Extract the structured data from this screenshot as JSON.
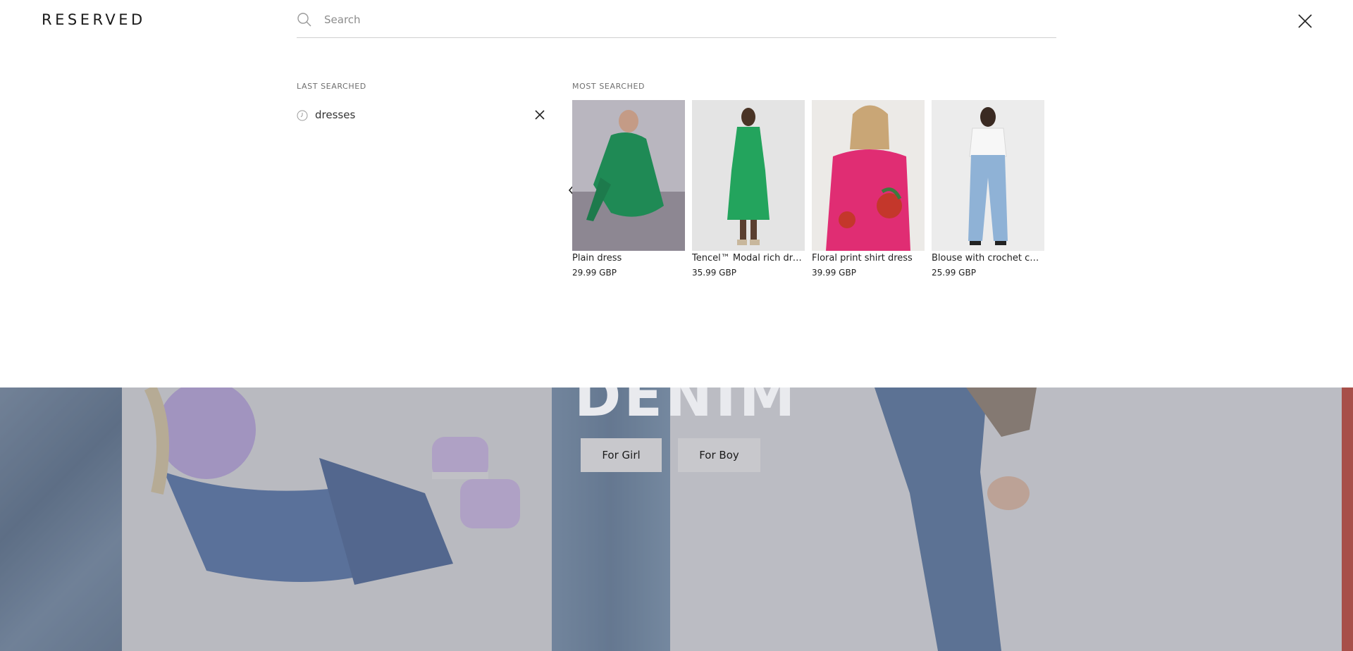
{
  "brand": {
    "logo_text": "RESERVED"
  },
  "search": {
    "placeholder": "Search",
    "value": ""
  },
  "last_searched": {
    "label": "LAST SEARCHED",
    "items": [
      {
        "term": "dresses"
      }
    ]
  },
  "most_searched": {
    "label": "MOST SEARCHED",
    "products": [
      {
        "name": "Plain dress",
        "price": "29.99 GBP",
        "image": "green-dress-seated"
      },
      {
        "name": "Tencel™ Modal rich dress",
        "price": "35.99 GBP",
        "image": "green-dress-standing"
      },
      {
        "name": "Floral print shirt dress",
        "price": "39.99 GBP",
        "image": "pink-floral-dress"
      },
      {
        "name": "Blouse with crochet coll...",
        "price": "25.99 GBP",
        "image": "white-blouse-jeans"
      }
    ]
  },
  "hero": {
    "heading": "DENIM",
    "buttons": [
      {
        "label": "For Girl"
      },
      {
        "label": "For Boy"
      }
    ]
  },
  "icons": {
    "search": "search-icon",
    "close": "close-icon",
    "clock": "clock-icon",
    "remove": "remove-icon",
    "prev": "chevron-left-icon"
  }
}
